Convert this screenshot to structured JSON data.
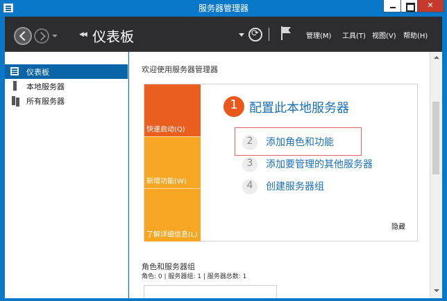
{
  "window": {
    "title": "服务器管理器"
  },
  "header": {
    "breadcrumb_title": "仪表板",
    "menus": [
      "管理(M)",
      "工具(T)",
      "视图(V)",
      "帮助(H)"
    ]
  },
  "sidebar": {
    "items": [
      {
        "label": "仪表板",
        "icon": "dashboard-icon",
        "active": true
      },
      {
        "label": "本地服务器",
        "icon": "server-icon",
        "active": false
      },
      {
        "label": "所有服务器",
        "icon": "servers-icon",
        "active": false
      }
    ]
  },
  "main": {
    "welcome_title": "欢迎使用服务器管理器",
    "tiles": [
      "快速启动(Q)",
      "新增功能(W)",
      "了解详细信息(L)"
    ],
    "steps": [
      {
        "num": "1",
        "label": "配置此本地服务器"
      },
      {
        "num": "2",
        "label": "添加角色和功能"
      },
      {
        "num": "3",
        "label": "添加要管理的其他服务器"
      },
      {
        "num": "4",
        "label": "创建服务器组"
      }
    ],
    "hide_label": "隐藏",
    "roles_title": "角色和服务器组",
    "roles_summary": "角色: 0 | 服务器组: 1 | 服务器总数: 1"
  },
  "colors": {
    "titlebar": "#0a78c8",
    "header": "#2d2d30",
    "active_item": "#0a64a8",
    "tile_orange": "#ea5e1f",
    "tile_amber": "#f6a623",
    "link_blue": "#1a6fb9",
    "highlight_border": "#e06060"
  }
}
